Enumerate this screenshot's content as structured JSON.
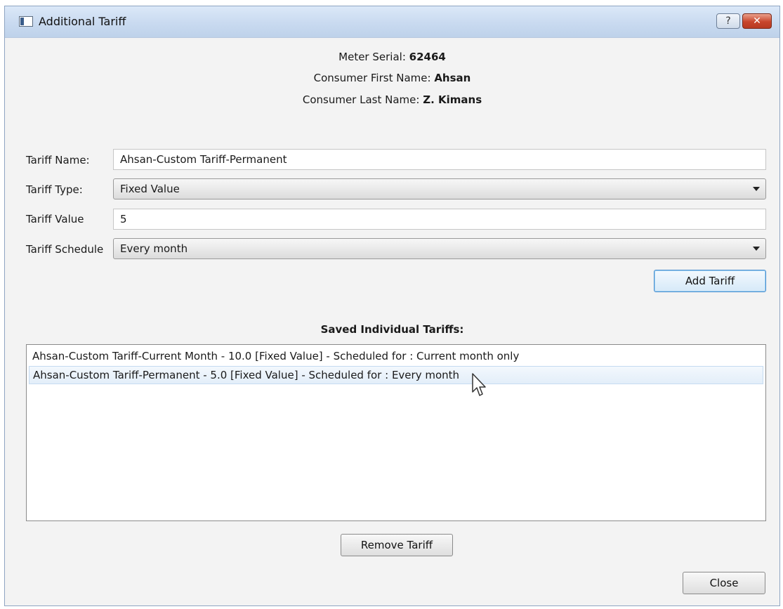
{
  "window": {
    "title": "Additional Tariff",
    "help_label": "?",
    "close_label": "✕"
  },
  "info": {
    "meter_serial_label": "Meter Serial:",
    "meter_serial_value": "62464",
    "first_name_label": "Consumer First Name:",
    "first_name_value": "Ahsan",
    "last_name_label": "Consumer Last Name:",
    "last_name_value": "Z. Kimans"
  },
  "form": {
    "tariff_name_label": "Tariff Name:",
    "tariff_name_value": "Ahsan-Custom Tariff-Permanent",
    "tariff_type_label": "Tariff Type:",
    "tariff_type_value": "Fixed Value",
    "tariff_value_label": "Tariff Value",
    "tariff_value_value": "5",
    "tariff_schedule_label": "Tariff Schedule",
    "tariff_schedule_value": "Every month",
    "add_button_label": "Add Tariff"
  },
  "saved": {
    "title": "Saved Individual Tariffs:",
    "items": [
      "Ahsan-Custom Tariff-Current Month - 10.0 [Fixed Value] - Scheduled for : Current month only",
      "Ahsan-Custom Tariff-Permanent - 5.0 [Fixed Value] - Scheduled for : Every month"
    ]
  },
  "actions": {
    "remove_button_label": "Remove Tariff",
    "close_button_label": "Close"
  }
}
